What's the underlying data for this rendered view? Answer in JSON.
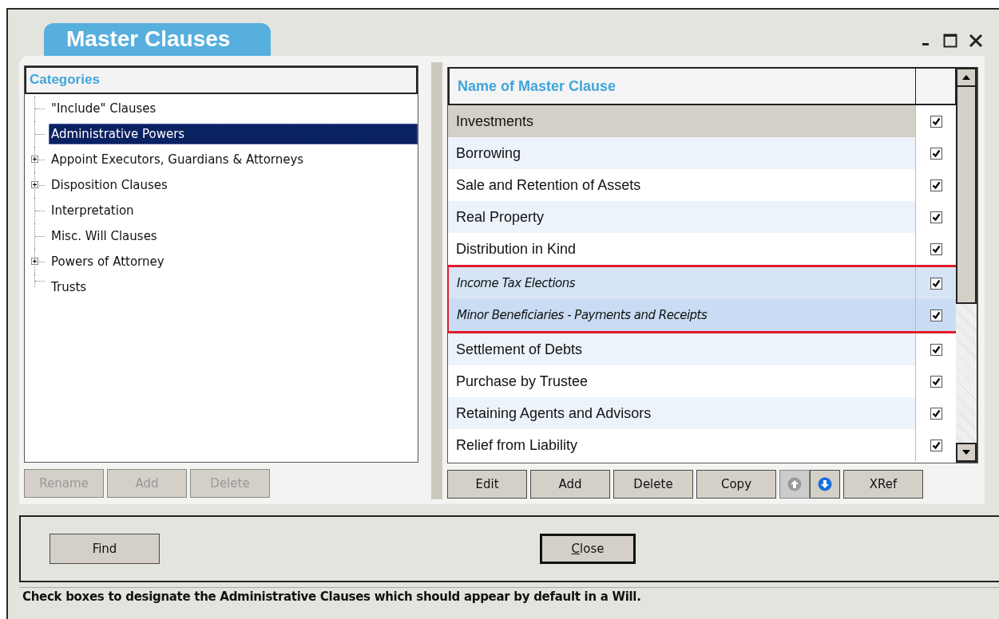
{
  "window": {
    "title": "Master Clauses"
  },
  "categories": {
    "heading": "Categories",
    "items": [
      {
        "label": "\"Include\" Clauses",
        "selected": false
      },
      {
        "label": "Administrative Powers",
        "selected": true
      },
      {
        "label": "Appoint Executors, Guardians & Attorneys",
        "selected": false,
        "expanded": false
      },
      {
        "label": "Disposition Clauses",
        "selected": false,
        "expanded": false
      },
      {
        "label": "Interpretation",
        "selected": false
      },
      {
        "label": "Misc. Will Clauses",
        "selected": false
      },
      {
        "label": "Powers of Attorney",
        "selected": false,
        "expanded": false
      },
      {
        "label": "Trusts",
        "selected": false
      }
    ],
    "buttons": [
      {
        "label": "Rename",
        "disabled": true
      },
      {
        "label": "Add",
        "disabled": true
      },
      {
        "label": "Delete",
        "disabled": true
      }
    ]
  },
  "clauses": {
    "column_1": "Name of Master Clause",
    "rows": [
      {
        "name": "Investments",
        "checked": true,
        "selected": true,
        "flagged": false
      },
      {
        "name": "Borrowing",
        "checked": true,
        "selected": false,
        "flagged": false
      },
      {
        "name": "Sale and Retention of Assets",
        "checked": true,
        "selected": false,
        "flagged": false
      },
      {
        "name": "Real Property",
        "checked": true,
        "selected": false,
        "flagged": false
      },
      {
        "name": "Distribution in Kind",
        "checked": true,
        "selected": false,
        "flagged": false
      },
      {
        "name": "Income Tax Elections",
        "checked": true,
        "selected": false,
        "flagged": true
      },
      {
        "name": "Minor Beneficiaries - Payments and Receipts",
        "checked": true,
        "selected": false,
        "flagged": true
      },
      {
        "name": "Settlement of Debts",
        "checked": true,
        "selected": false,
        "flagged": false
      },
      {
        "name": "Purchase by Trustee",
        "checked": true,
        "selected": false,
        "flagged": false
      },
      {
        "name": "Retaining Agents and Advisors",
        "checked": true,
        "selected": false,
        "flagged": false
      },
      {
        "name": "Relief from Liability",
        "checked": true,
        "selected": false,
        "flagged": false
      }
    ],
    "buttons": [
      {
        "kind": "text",
        "label": "Edit"
      },
      {
        "kind": "text",
        "label": "Add"
      },
      {
        "kind": "text",
        "label": "Delete"
      },
      {
        "kind": "text",
        "label": "Copy"
      },
      {
        "kind": "up",
        "disabled": true
      },
      {
        "kind": "down",
        "disabled": false
      },
      {
        "kind": "text",
        "label": "XRef"
      }
    ]
  },
  "footer_buttons": [
    {
      "label": "Find",
      "default": false
    },
    {
      "label": "Close",
      "default": true
    }
  ],
  "status_bar": "Check boxes to designate the Administrative Clauses which should appear by default in a Will."
}
